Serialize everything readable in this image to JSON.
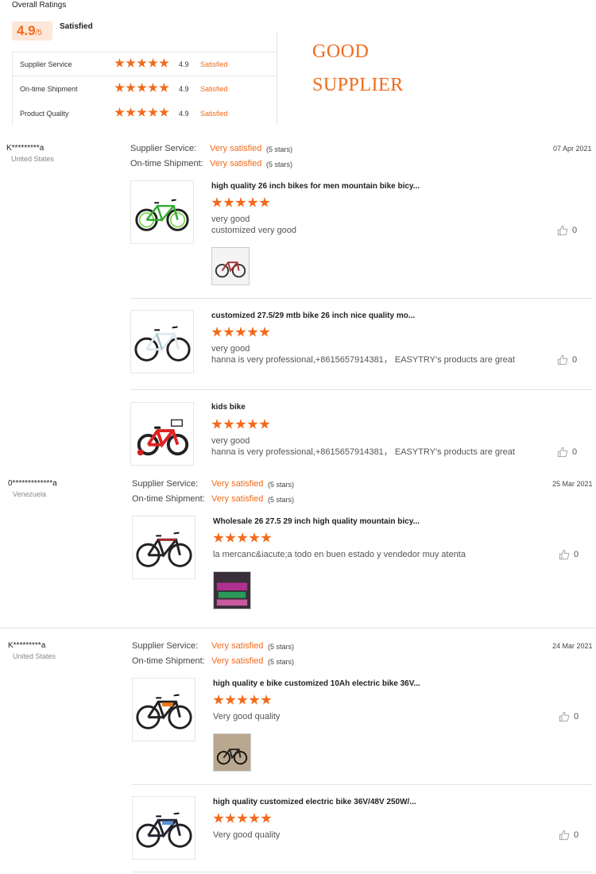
{
  "summary": {
    "title": "Overall Ratings",
    "score": "4.9",
    "score_max": "/5",
    "score_text": "Satisfied",
    "rows": [
      {
        "label": "Supplier Service",
        "stars": 5,
        "value": "4.9",
        "status": "Satisfied"
      },
      {
        "label": "On-time Shipment",
        "stars": 5,
        "value": "4.9",
        "status": "Satisfied"
      },
      {
        "label": "Product Quality",
        "stars": 5,
        "value": "4.9",
        "status": "Satisfied"
      }
    ],
    "banner_line1": "GOOD",
    "banner_line2": "SUPPLIER"
  },
  "labels": {
    "supplier_service": "Supplier Service:",
    "ontime_shipment": "On-time Shipment:",
    "very_satisfied": "Very satisfied",
    "five_stars": "(5 stars)"
  },
  "reviews": [
    {
      "name": "K*********a",
      "country": "United States",
      "date": "07 Apr 2021",
      "products": [
        {
          "title": "high quality 26 inch bikes for men mountain bike bicy...",
          "stars": 5,
          "comment1": "very good",
          "comment2": "customized very good",
          "likes": "0"
        },
        {
          "title": "customized 27.5/29 mtb bike 26 inch nice quality mo...",
          "stars": 5,
          "comment1": "very good",
          "comment2": "hanna is very professional,+8615657914381，  EASYTRY's products are great",
          "likes": "0"
        },
        {
          "title": "kids bike",
          "stars": 5,
          "comment1": "very good",
          "comment2": "hanna is very professional,+8615657914381，  EASYTRY's products are great",
          "likes": "0"
        }
      ]
    },
    {
      "name": "0*************a",
      "country": "Venezuela",
      "date": "25 Mar 2021",
      "products": [
        {
          "title": "Wholesale 26 27.5 29 inch high quality mountain bicy...",
          "stars": 5,
          "comment1": "la mercanc&iacute;a todo en buen estado y vendedor muy atenta",
          "likes": "0"
        }
      ]
    },
    {
      "name": "K*********a",
      "country": "United States",
      "date": "24 Mar 2021",
      "products": [
        {
          "title": "high quality e bike customized 10Ah electric bike 36V...",
          "stars": 5,
          "comment1": "Very good quality",
          "likes": "0"
        },
        {
          "title": "high quality customized electric bike 36V/48V 250W/...",
          "stars": 5,
          "comment1": "Very good quality",
          "likes": "0"
        }
      ]
    }
  ]
}
